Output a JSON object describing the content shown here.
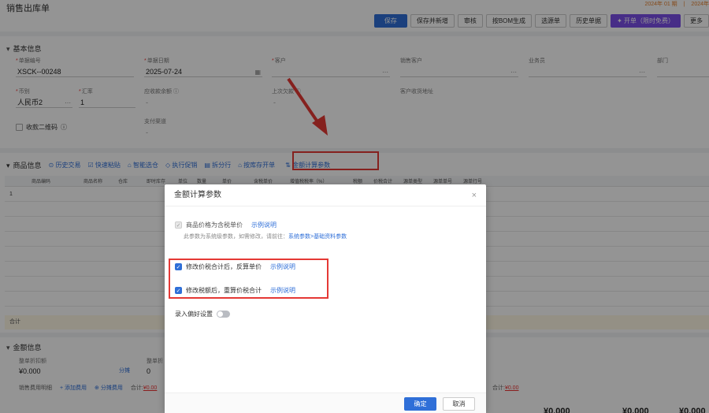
{
  "app": {
    "title": "销售出库单",
    "period": [
      "2024年 01 期",
      "|",
      "2024年"
    ],
    "toolbar": [
      "保存",
      "保存并新增",
      "审核",
      "按BOM生成",
      "选源单",
      "历史单据",
      "开单（限时免费）",
      "更多"
    ]
  },
  "basic": {
    "section_title": "基本信息",
    "fields": [
      {
        "label": "单据编号",
        "required": true,
        "value": "XSCK--00248"
      },
      {
        "label": "单据日期",
        "required": true,
        "value": "2025-07-24"
      },
      {
        "label": "客户",
        "required": true,
        "value": ""
      },
      {
        "label": "销售客户",
        "required": false,
        "value": ""
      },
      {
        "label": "业务员",
        "required": false,
        "value": ""
      },
      {
        "label": "部门",
        "required": false,
        "value": ""
      },
      {
        "label": "币别",
        "required": true,
        "value": "人民币2"
      },
      {
        "label": "汇率",
        "required": true,
        "value": "1"
      },
      {
        "label": "应收款余额",
        "required": false,
        "value": "-"
      },
      {
        "label": "上次欠款",
        "required": false,
        "value": "-"
      },
      {
        "label": "客户收货地址",
        "required": false,
        "value": ""
      },
      {
        "label": "支付渠道",
        "required": false,
        "value": "-"
      }
    ],
    "qr_label": "收款二维码"
  },
  "goods": {
    "section_title": "商品信息",
    "links": [
      "历史交易",
      "快速粘贴",
      "智能选仓",
      "执行促销",
      "拆分行",
      "按库存开单",
      "金额计算参数"
    ],
    "columns": [
      "商品编码",
      "商品名称",
      "仓库",
      "即时库存",
      "单位",
      "数量",
      "单价",
      "含税单价",
      "增值税税率（%）",
      "税额",
      "价税合计",
      "源单类型",
      "源单单号",
      "源单行号"
    ],
    "rows": [
      "1",
      "",
      "",
      "",
      "",
      "",
      "",
      "",
      ""
    ],
    "total_label": "合计"
  },
  "amount": {
    "section_title": "金额信息",
    "discount_label": "整单折扣额",
    "discount_value": "¥0.000",
    "share_link": "分摊",
    "after_label": "整单折",
    "after_value": "0",
    "fee_label": "销售费用明细",
    "add_fee": "添加费用",
    "share_fee": "分摊费用",
    "total_prefix": "合计:",
    "total_value": "¥0.00",
    "total_prefix_2": "合计:",
    "total_value_2": "¥0.00",
    "bottom_values": [
      "¥0.000",
      "¥0.000",
      "¥0.000"
    ]
  },
  "modal": {
    "title": "金额计算参数",
    "opt1_label": "商品价格为含税单价",
    "opt1_example": "示例说明",
    "note_prefix": "此参数为系统级参数，如需修改，请前往：",
    "note_link": "系统参数>基础资料参数",
    "opt2_label": "修改价税合计后，反算单价",
    "opt2_example": "示例说明",
    "opt3_label": "修改税额后，重算价税合计",
    "opt3_example": "示例说明",
    "toggle_label": "录入偏好设置",
    "ok": "确定",
    "cancel": "取消"
  }
}
